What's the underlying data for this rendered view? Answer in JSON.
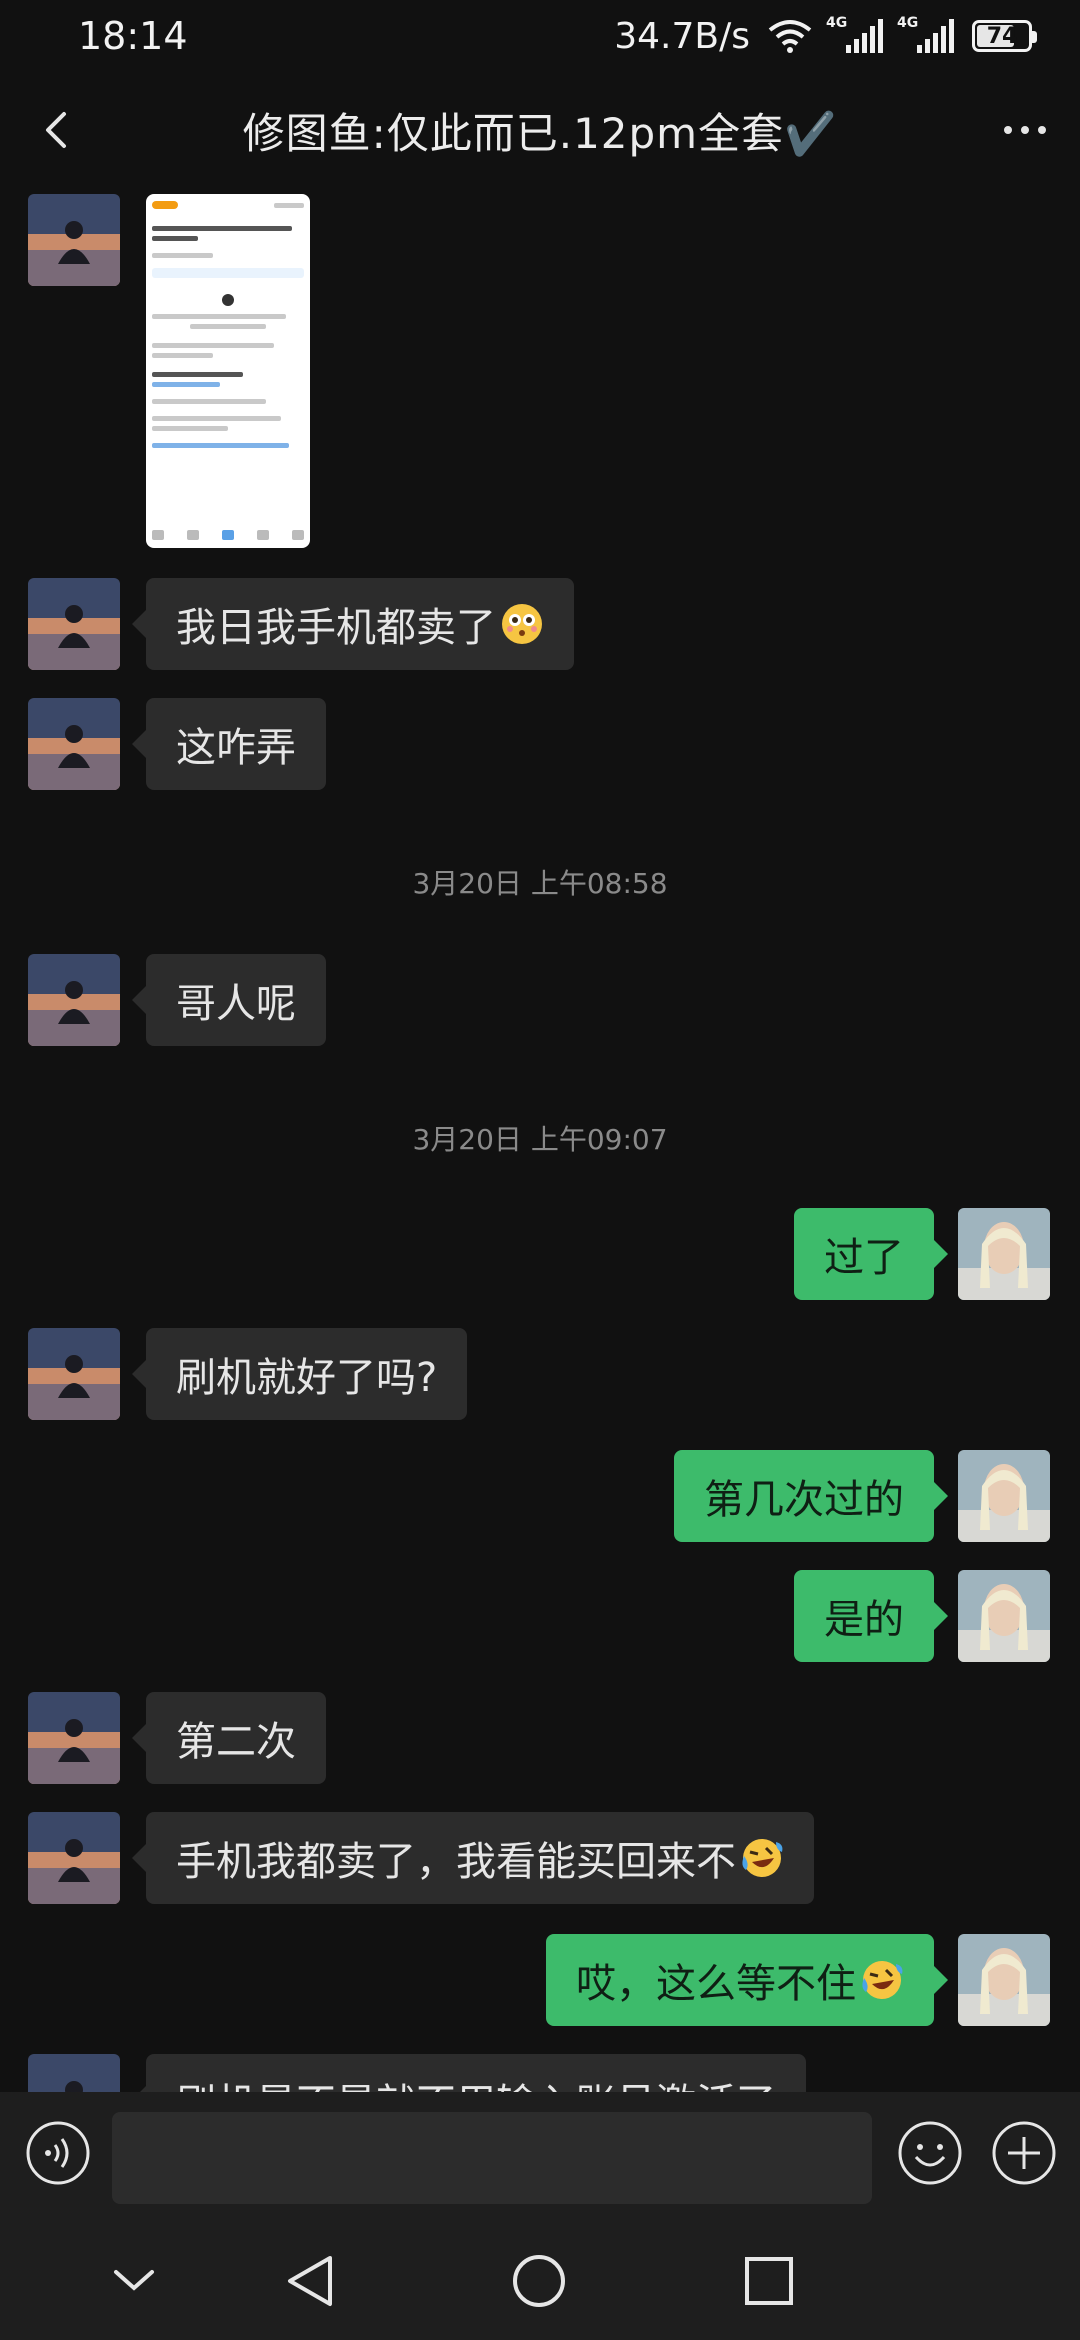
{
  "status_bar": {
    "time": "18:14",
    "net_speed": "34.7B/s",
    "sim1_label": "4G",
    "sim2_label": "4G",
    "battery_level": "74",
    "battery_fraction": 0.74
  },
  "header": {
    "title": "修图鱼:仅此而已.12pm全套✔️",
    "back_icon": "chevron-left-icon",
    "more_icon": "more-dots-icon"
  },
  "messages": [
    {
      "type": "image",
      "side": "in",
      "description_icon": "screenshot-thumbnail"
    },
    {
      "type": "text",
      "side": "in",
      "text": "我日我手机都卖了",
      "emoji": "flushed-face"
    },
    {
      "type": "text",
      "side": "in",
      "text": "这咋弄"
    },
    {
      "type": "timestamp",
      "text": "3月20日 上午08:58"
    },
    {
      "type": "text",
      "side": "in",
      "text": "哥人呢"
    },
    {
      "type": "timestamp",
      "text": "3月20日 上午09:07"
    },
    {
      "type": "text",
      "side": "out",
      "text": "过了"
    },
    {
      "type": "text",
      "side": "in",
      "text": "刷机就好了吗?"
    },
    {
      "type": "text",
      "side": "out",
      "text": "第几次过的"
    },
    {
      "type": "text",
      "side": "out",
      "text": "是的"
    },
    {
      "type": "text",
      "side": "in",
      "text": "第二次"
    },
    {
      "type": "text",
      "side": "in",
      "text": "手机我都卖了，我看能买回来不",
      "emoji": "laughing-tears-face"
    },
    {
      "type": "text",
      "side": "out",
      "text": "哎，这么等不住",
      "emoji": "laughing-tears-face"
    },
    {
      "type": "text",
      "side": "in",
      "text": "刷机是不是就不用输入账号激活了"
    }
  ],
  "input_bar": {
    "placeholder": "",
    "voice_icon": "voice-icon",
    "emoji_icon": "smiley-icon",
    "plus_icon": "plus-icon"
  },
  "nav_bar": {
    "icons": [
      "chevron-down-icon",
      "back-triangle-icon",
      "home-circle-icon",
      "recents-square-icon"
    ]
  },
  "colors": {
    "background": "#111111",
    "incoming_bubble": "#2c2c2c",
    "outgoing_bubble": "#3dbb6b",
    "timestamp_text": "#8a8a8a"
  }
}
